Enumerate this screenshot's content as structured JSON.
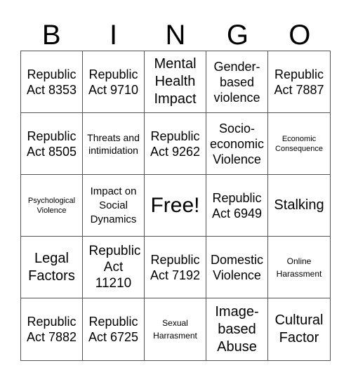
{
  "header": {
    "letters": [
      "B",
      "I",
      "N",
      "G",
      "O"
    ]
  },
  "board": {
    "rows": [
      [
        "Republic Act 8353",
        "Republic Act 9710",
        "Mental Health Impact",
        "Gender-based violence",
        "Republic Act 7887"
      ],
      [
        "Republic Act 8505",
        "Threats and intimidation",
        "Republic Act 9262",
        "Socio-economic Violence",
        "Economic Consequence"
      ],
      [
        "Psychological Violence",
        "Impact on Social Dynamics",
        "Free!",
        "Republic Act 6949",
        "Stalking"
      ],
      [
        "Legal Factors",
        "Republic Act 11210",
        "Republic Act 7192",
        "Domestic Violence",
        "Online Harassment"
      ],
      [
        "Republic Act 7882",
        "Republic Act 6725",
        "Sexual Harrasment",
        "Image-based Abuse",
        "Cultural Factor"
      ]
    ]
  },
  "colors": {
    "grid_line": "#555555",
    "text": "#000000",
    "background": "#ffffff"
  }
}
